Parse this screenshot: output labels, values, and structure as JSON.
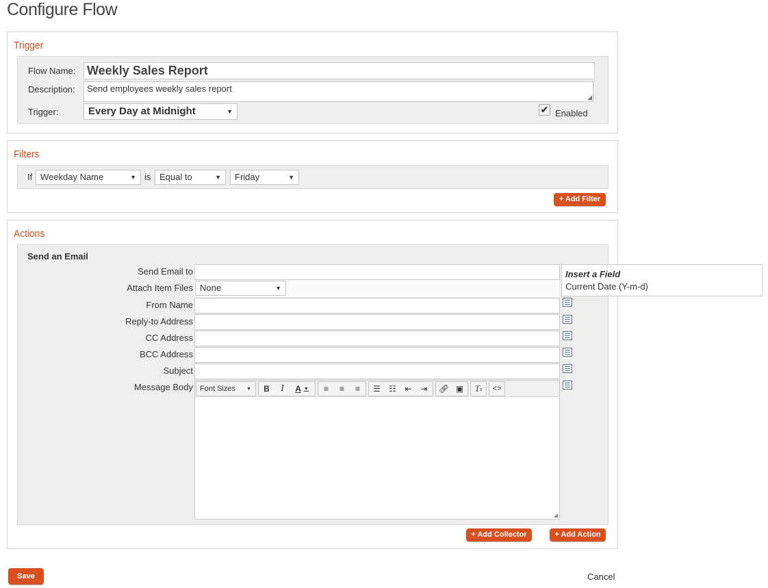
{
  "page_title": "Configure Flow",
  "trigger": {
    "title": "Trigger",
    "flow_name_label": "Flow Name:",
    "flow_name_value": "Weekly Sales Report",
    "description_label": "Description:",
    "description_value": "Send employees weekly sales report",
    "trigger_label": "Trigger:",
    "trigger_value": "Every Day at Midnight",
    "enabled_label": "Enabled",
    "enabled": true
  },
  "filters": {
    "title": "Filters",
    "if_label": "If",
    "field_value": "Weekday Name",
    "is_label": "is",
    "operator_value": "Equal to",
    "compare_value": "Friday",
    "add_filter_label": "+ Add Filter"
  },
  "actions": {
    "title": "Actions",
    "email": {
      "heading": "Send an Email",
      "send_to_label": "Send Email to",
      "attach_label": "Attach Item Files",
      "attach_value": "None",
      "from_label": "From Name",
      "reply_to_label": "Reply-to Address",
      "cc_label": "CC Address",
      "bcc_label": "BCC Address",
      "subject_label": "Subject",
      "body_label": "Message Body",
      "font_sizes_label": "Font Sizes"
    },
    "insert_field": {
      "title": "Insert a Field",
      "option": "Current Date (Y-m-d)"
    },
    "add_collector_label": "+ Add Collector",
    "add_action_label": "+ Add Action"
  },
  "footer": {
    "save_label": "Save",
    "cancel_label": "Cancel"
  },
  "colors": {
    "accent": "#d9501f",
    "section_title": "#d04d1f"
  }
}
